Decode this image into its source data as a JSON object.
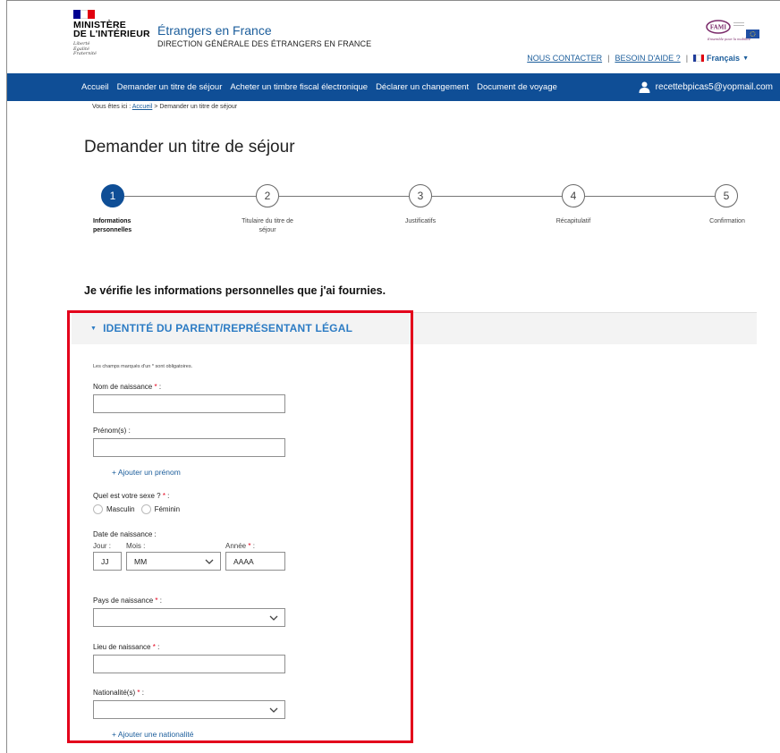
{
  "header": {
    "ministry_lines": [
      "MINISTÈRE",
      "DE L'INTÉRIEUR"
    ],
    "devise_lines": [
      "Liberté",
      "Égalité",
      "Fraternité"
    ],
    "site_title": "Étrangers en France",
    "site_subtitle": "DIRECTION GÉNÉRALE DES ÉTRANGERS EN FRANCE",
    "contact_link": "NOUS CONTACTER",
    "help_link": "BESOIN D'AIDE ?",
    "separator": "|",
    "language": "Français",
    "partner_logo_text": "FAMI",
    "partner_tagline": "Ensemble pour la mobilité"
  },
  "nav": {
    "items": [
      "Accueil",
      "Demander un titre de séjour",
      "Acheter un timbre fiscal électronique",
      "Déclarer un changement",
      "Document de voyage"
    ],
    "user_email": "recettebpicas5@yopmail.com"
  },
  "breadcrumb": {
    "prefix": "Vous êtes ici :",
    "home": "Accueil",
    "current": "> Demander un titre de séjour"
  },
  "page": {
    "title": "Demander un titre de séjour",
    "verify_heading": "Je vérifie les informations personnelles que j'ai fournies."
  },
  "steps": [
    {
      "number": "1",
      "label_lines": [
        "Informations",
        "personnelles"
      ],
      "active": true
    },
    {
      "number": "2",
      "label_lines": [
        "Titulaire du titre de",
        "séjour"
      ],
      "active": false
    },
    {
      "number": "3",
      "label_lines": [
        "Justificatifs"
      ],
      "active": false
    },
    {
      "number": "4",
      "label_lines": [
        "Récapitulatif"
      ],
      "active": false
    },
    {
      "number": "5",
      "label_lines": [
        "Confirmation"
      ],
      "active": false
    }
  ],
  "section": {
    "title": "IDENTITÉ DU PARENT/REPRÉSENTANT LÉGAL",
    "mandatory_note": "Les champs marqués d'un * sont obligatoires.",
    "fields": {
      "birth_name_label": "Nom de naissance",
      "first_names_label": "Prénom(s) :",
      "add_first_name": "+ Ajouter un prénom",
      "sex_label": "Quel est votre sexe ?",
      "sex_options": [
        "Masculin",
        "Féminin"
      ],
      "birth_date_label": "Date de naissance :",
      "day_label": "Jour :",
      "month_label": "Mois :",
      "year_label": "Année",
      "day_placeholder": "JJ",
      "month_placeholder": "MM",
      "year_placeholder": "AAAA",
      "birth_country_label": "Pays de naissance",
      "birth_place_label": "Lieu de naissance",
      "nationality_label": "Nationalité(s)",
      "add_nationality": "+ Ajouter une nationalité",
      "required_mark": "*",
      "colon": " :"
    }
  },
  "colors": {
    "nav_bg": "#0f4e96",
    "link": "#1b5d9b",
    "section_title": "#2d7cc4",
    "highlight": "#e3001b"
  }
}
